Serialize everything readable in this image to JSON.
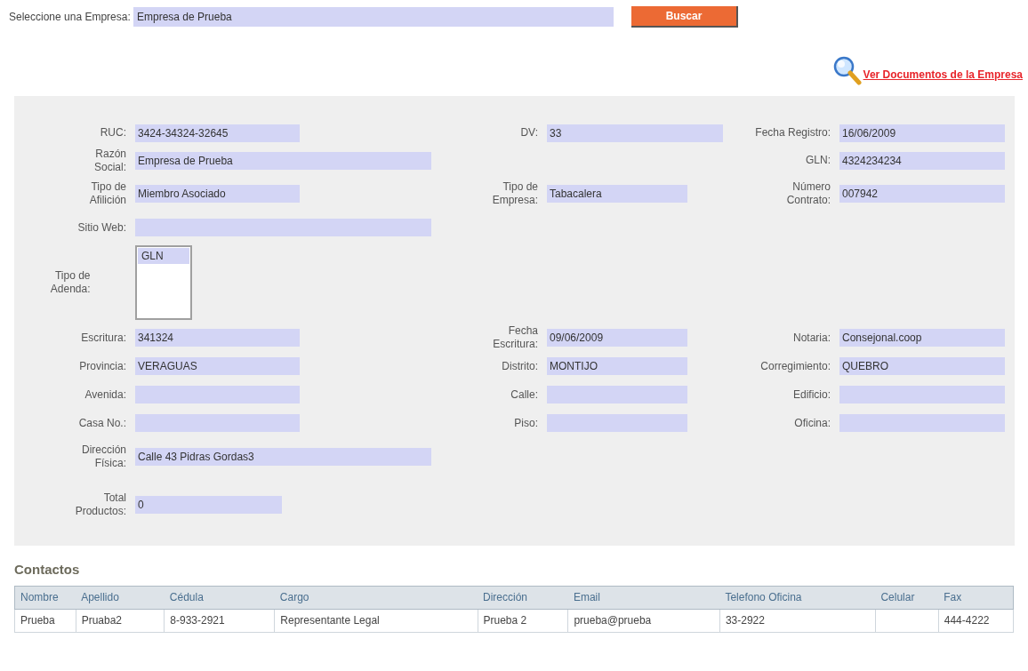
{
  "search": {
    "label": "Seleccione una Empresa:",
    "value": "Empresa de Prueba",
    "button": "Buscar"
  },
  "documents_link": "Ver Documentos de la Empresa",
  "form": {
    "rows": [
      {
        "left": {
          "kind": "text",
          "label": "RUC:",
          "value": "3424-34324-32645"
        },
        "middle": {
          "kind": "text",
          "label": "DV:",
          "value": "33"
        },
        "right": {
          "kind": "text",
          "label": "Fecha Registro:",
          "value": "16/06/2009"
        }
      },
      {
        "left": {
          "kind": "text",
          "label": "Razón Social:",
          "value": "Empresa de Prueba"
        },
        "right": {
          "kind": "text",
          "label": "GLN:",
          "value": "4324234234"
        }
      },
      {
        "left": {
          "kind": "text",
          "label": "Tipo de Afilición",
          "value": "Miembro Asociado"
        },
        "middle": {
          "kind": "text",
          "label": "Tipo de Empresa:",
          "value": "Tabacalera"
        },
        "right": {
          "kind": "text",
          "label": "Número Contrato:",
          "value": "007942"
        }
      },
      {
        "left": {
          "kind": "text",
          "label": "Sitio Web:"
        }
      },
      {
        "left": {
          "kind": "listbox",
          "label": "Tipo de Adenda:",
          "options": [
            {
              "label": "GLN",
              "selected": true
            }
          ]
        }
      },
      {
        "left": {
          "kind": "text",
          "label": "Escritura:",
          "value": "341324"
        },
        "middle": {
          "kind": "text",
          "label": "Fecha Escritura:",
          "value": "09/06/2009"
        },
        "right": {
          "kind": "text",
          "label": "Notaria:",
          "value": "Consejonal.coop"
        }
      },
      {
        "left": {
          "kind": "text",
          "label": "Provincia:",
          "value": "VERAGUAS"
        },
        "middle": {
          "kind": "text",
          "label": "Distrito:",
          "value": "MONTIJO"
        },
        "right": {
          "kind": "text",
          "label": "Corregimiento:",
          "value": "QUEBRO"
        }
      },
      {
        "left": {
          "kind": "text",
          "label": "Avenida:"
        },
        "middle": {
          "kind": "text",
          "label": "Calle:"
        },
        "right": {
          "kind": "text",
          "label": "Edificio:"
        }
      },
      {
        "left": {
          "kind": "text",
          "label": "Casa No.:"
        },
        "middle": {
          "kind": "text",
          "label": "Piso:"
        },
        "right": {
          "kind": "text",
          "label": "Oficina:"
        }
      },
      {
        "left": {
          "kind": "text",
          "label": "Dirección Física:",
          "value": "Calle 43 Pidras Gordas3"
        }
      },
      {
        "left": {
          "kind": "text",
          "label": "Total Productos:",
          "value": "0"
        }
      }
    ]
  },
  "contacts": {
    "title": "Contactos",
    "columns": [
      "Nombre",
      "Apellido",
      "Cédula",
      "Cargo",
      "Dirección",
      "Email",
      "Telefono Oficina",
      "Celular",
      "Fax"
    ],
    "rows": [
      [
        "Prueba",
        "Pruaba2",
        "8-933-2921",
        "Representante Legal",
        "Prueba 2",
        "prueba@prueba",
        "33-2922",
        "",
        "444-4222"
      ]
    ]
  }
}
